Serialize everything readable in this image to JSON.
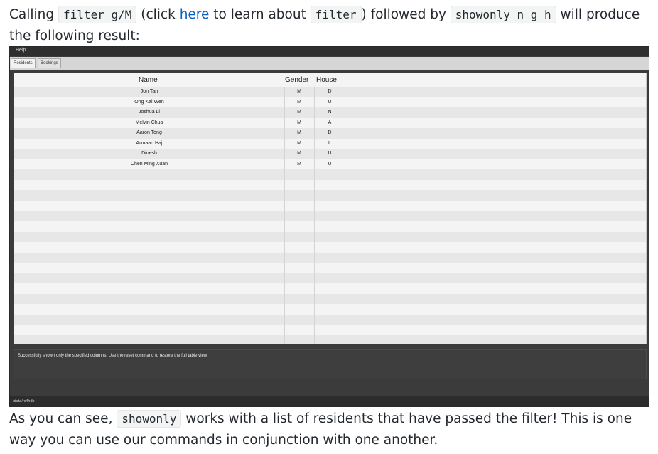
{
  "intro": {
    "t1": "Calling ",
    "code1": "filter g/M",
    "t2": " (click ",
    "link": "here",
    "t3": " to learn about ",
    "code2": "filter",
    "t4": ") followed by ",
    "code3": "showonly n g h",
    "t5": " will produce the following result:"
  },
  "app": {
    "menu": {
      "help": "Help"
    },
    "tabs": [
      {
        "label": "Residents"
      },
      {
        "label": "Bookings"
      }
    ],
    "table": {
      "headers": {
        "name": "Name",
        "gender": "Gender",
        "house": "House"
      },
      "rows": [
        {
          "name": "Jon Tan",
          "gender": "M",
          "house": "D"
        },
        {
          "name": "Ong Kai Wen",
          "gender": "M",
          "house": "U"
        },
        {
          "name": "Joshua Li",
          "gender": "M",
          "house": "N"
        },
        {
          "name": "Melvin Chua",
          "gender": "M",
          "house": "A"
        },
        {
          "name": "Aaron Tong",
          "gender": "M",
          "house": "D"
        },
        {
          "name": "Armaan Haj",
          "gender": "M",
          "house": "L"
        },
        {
          "name": "Dinesh",
          "gender": "M",
          "house": "U"
        },
        {
          "name": "Chen Ming Xuan",
          "gender": "M",
          "house": "U"
        }
      ]
    },
    "result": "Successfully shown only the specified columns. Use the reset command to restore the full table view.",
    "status": "/data/rc4hdb"
  },
  "outro": {
    "t1": "As you can see, ",
    "code": "showonly",
    "t2": " works with a list of residents that have passed the filter! This is one way you can use our commands in conjunction with one another."
  }
}
